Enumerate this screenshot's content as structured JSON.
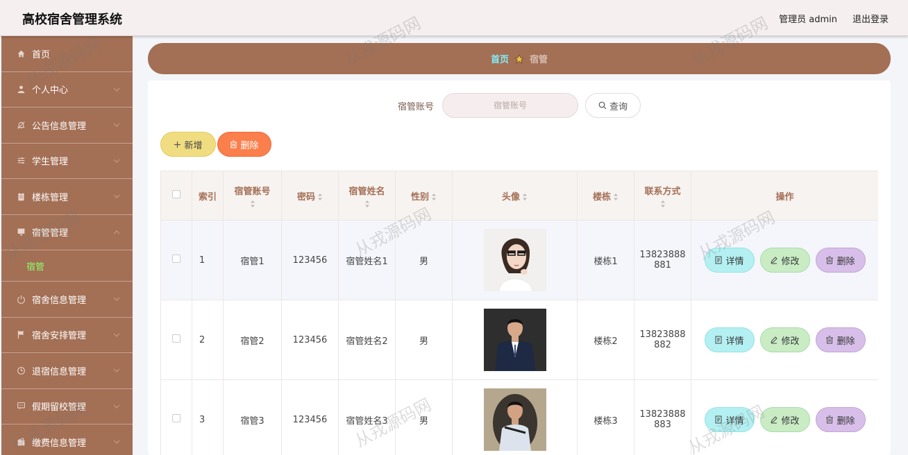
{
  "app": {
    "title": "高校宿舍管理系统",
    "user_label": "管理员 admin",
    "logout_label": "退出登录"
  },
  "sidebar": {
    "items": [
      {
        "label": "首页",
        "icon": "home-icon"
      },
      {
        "label": "个人中心",
        "icon": "user-icon"
      },
      {
        "label": "公告信息管理",
        "icon": "bell-icon"
      },
      {
        "label": "学生管理",
        "icon": "sliders-icon"
      },
      {
        "label": "楼栋管理",
        "icon": "clipboard-icon"
      },
      {
        "label": "宿管管理",
        "icon": "monitor-icon",
        "expanded": true,
        "sub": [
          {
            "label": "宿管",
            "active": true
          }
        ]
      },
      {
        "label": "宿舍信息管理",
        "icon": "power-icon"
      },
      {
        "label": "宿舍安排管理",
        "icon": "flag-icon"
      },
      {
        "label": "退宿信息管理",
        "icon": "clock-icon"
      },
      {
        "label": "假期留校管理",
        "icon": "chat-icon"
      },
      {
        "label": "缴费信息管理",
        "icon": "wallet-icon"
      }
    ]
  },
  "breadcrumb": {
    "home": "首页",
    "current": "宿管"
  },
  "search": {
    "label": "宿管账号",
    "placeholder": "宿管账号",
    "value": "",
    "button": "查询"
  },
  "actions": {
    "add": "新增",
    "delete": "删除"
  },
  "table": {
    "headers": {
      "index": "索引",
      "account": "宿管账号",
      "password": "密码",
      "name": "宿管姓名",
      "gender": "性别",
      "avatar": "头像",
      "building": "楼栋",
      "phone": "联系方式",
      "ops": "操作"
    },
    "ops": {
      "detail": "详情",
      "edit": "修改",
      "delete": "删除"
    },
    "rows": [
      {
        "index": "1",
        "account": "宿管1",
        "password": "123456",
        "name": "宿管姓名1",
        "gender": "男",
        "building": "楼栋1",
        "phone_l1": "13823888",
        "phone_l2": "881"
      },
      {
        "index": "2",
        "account": "宿管2",
        "password": "123456",
        "name": "宿管姓名2",
        "gender": "男",
        "building": "楼栋2",
        "phone_l1": "13823888",
        "phone_l2": "882"
      },
      {
        "index": "3",
        "account": "宿管3",
        "password": "123456",
        "name": "宿管姓名3",
        "gender": "男",
        "building": "楼栋3",
        "phone_l1": "13823888",
        "phone_l2": "883"
      }
    ]
  },
  "watermark": "从戎源码网",
  "colors": {
    "sidebar": "#a36f55",
    "breadcrumb_home": "#7ef0f7",
    "submenu_active": "#8dff6c",
    "add_button": "#f1dd81",
    "delete_button": "#fa7f4c"
  }
}
